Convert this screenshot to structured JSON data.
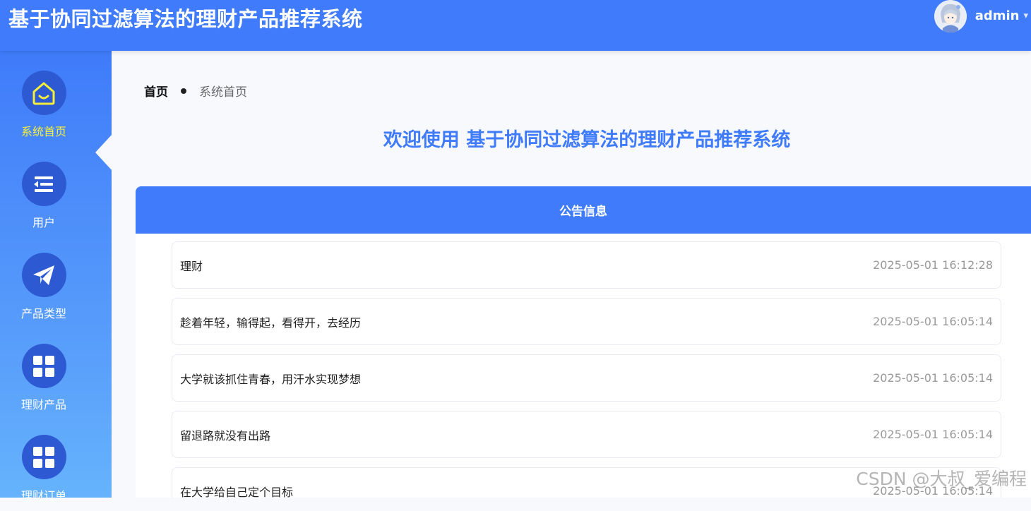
{
  "header": {
    "app_title": "基于协同过滤算法的理财产品推荐系统",
    "username": "admin",
    "caret": "▾",
    "bg_color": "#3f7bfa"
  },
  "sidebar": {
    "items": [
      {
        "label": "系统首页",
        "icon": "home-icon",
        "active": true
      },
      {
        "label": "用户",
        "icon": "list-icon",
        "active": false
      },
      {
        "label": "产品类型",
        "icon": "paper-plane-icon",
        "active": false
      },
      {
        "label": "理财产品",
        "icon": "grid-icon",
        "active": false
      },
      {
        "label": "理财订单",
        "icon": "grid-icon",
        "active": false
      }
    ],
    "active_color": "#f5ef3a"
  },
  "breadcrumb": {
    "home": "首页",
    "current": "系统首页"
  },
  "welcome": "欢迎使用 基于协同过滤算法的理财产品推荐系统",
  "notice": {
    "header": "公告信息",
    "items": [
      {
        "title": "理财",
        "time": "2025-05-01 16:12:28"
      },
      {
        "title": "趁着年轻，输得起，看得开，去经历",
        "time": "2025-05-01 16:05:14"
      },
      {
        "title": "大学就该抓住青春，用汗水实现梦想",
        "time": "2025-05-01 16:05:14"
      },
      {
        "title": "留退路就没有出路",
        "time": "2025-05-01 16:05:14"
      },
      {
        "title": "在大学给自己定个目标",
        "time": "2025-05-01 16:05:14"
      }
    ]
  },
  "watermark": "CSDN @大叔_爱编程"
}
